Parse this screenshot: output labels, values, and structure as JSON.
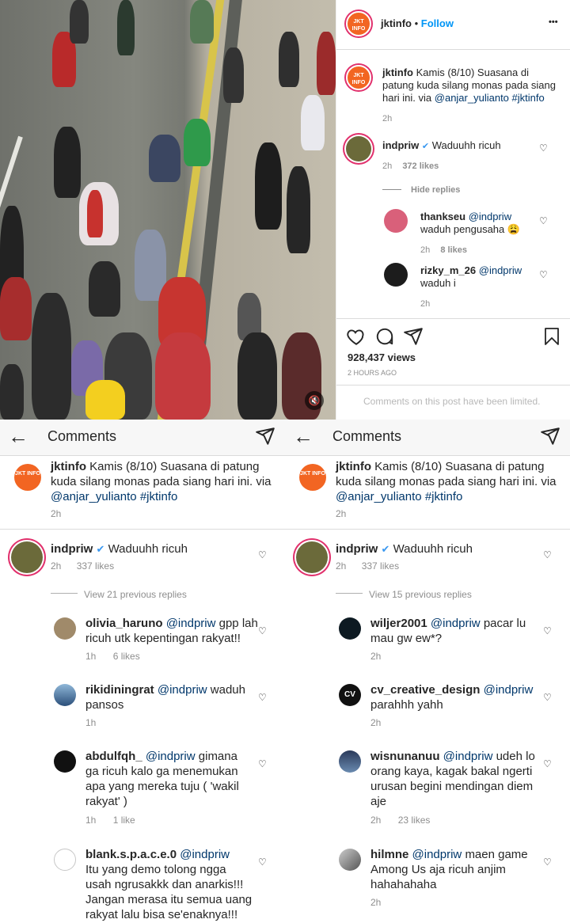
{
  "post": {
    "username": "jktinfo",
    "follow": "Follow",
    "avatar_text": "JKT INFO",
    "more": "•••",
    "caption_user": "jktinfo",
    "caption": "Kamis (8/10) Suasana di patung kuda silang monas pada siang hari ini. via",
    "caption_mention": "@anjar_yulianto",
    "caption_tag": "#jktinfo",
    "caption_time": "2h",
    "views": "928,437 views",
    "time_ago": "2 HOURS AGO",
    "limited": "Comments on this post have been limited.",
    "mute_icon": "mute-icon"
  },
  "panel_comments": {
    "main": {
      "user": "indpriw",
      "verified": "✔",
      "text": "Waduuhh ricuh",
      "time": "2h",
      "likes": "372 likes"
    },
    "hide_replies": "Hide replies",
    "replies": [
      {
        "user": "thankseu",
        "mention": "@indpriw",
        "text": "waduh pengusaha 😩",
        "time": "2h",
        "likes": "8 likes"
      },
      {
        "user": "rizky_m_26",
        "mention": "@indpriw",
        "text": "waduh i",
        "time": "2h",
        "likes": ""
      }
    ]
  },
  "left": {
    "header": "Comments",
    "caption_user": "jktinfo",
    "caption": "Kamis (8/10) Suasana di patung kuda silang monas pada siang hari ini.",
    "caption_via": "via",
    "caption_mention": "@anjar_yulianto",
    "caption_tag": "#jktinfo",
    "caption_time": "2h",
    "main": {
      "user": "indpriw",
      "text": "Waduuhh ricuh",
      "time": "2h",
      "likes": "337 likes"
    },
    "view_replies": "View 21 previous replies",
    "replies": [
      {
        "user": "olivia_haruno",
        "mention": "@indpriw",
        "line1": "gpp lah",
        "line2": "ricuh utk kepentingan rakyat!!",
        "line3": "",
        "line4": "",
        "time": "1h",
        "likes": "6 likes"
      },
      {
        "user": "rikidiningrat",
        "mention": "@indpriw",
        "line1": "waduh",
        "line2": "pansos",
        "line3": "",
        "line4": "",
        "time": "1h",
        "likes": ""
      },
      {
        "user": "abdulfqh_",
        "mention": "@indpriw",
        "line1": "gimana",
        "line2": "ga ricuh kalo ga menemukan",
        "line3": "apa yang mereka tuju ( 'wakil",
        "line4": "rakyat' )",
        "time": "1h",
        "likes": "1 like"
      },
      {
        "user": "blank.s.p.a.c.e.0",
        "mention": "@indpriw",
        "line1": "",
        "line2": "Itu yang demo tolong ngga",
        "line3": "usah ngrusakkk dan anarkis!!!",
        "line4": "Jangan merasa itu semua uang",
        "line5": "rakyat lalu bisa se'enaknya!!!",
        "time": "",
        "likes": ""
      }
    ]
  },
  "right": {
    "header": "Comments",
    "caption_user": "jktinfo",
    "caption": "Kamis (8/10) Suasana di patung kuda silang monas pada siang hari ini.",
    "caption_via": "via",
    "caption_mention": "@anjar_yulianto",
    "caption_tag": "#jktinfo",
    "caption_time": "2h",
    "main": {
      "user": "indpriw",
      "text": "Waduuhh ricuh",
      "time": "2h",
      "likes": "337 likes"
    },
    "view_replies": "View 15 previous replies",
    "replies": [
      {
        "user": "wiljer2001",
        "mention": "@indpriw",
        "line1": "pacar lu",
        "line2": "mau gw ew*?",
        "line3": "",
        "line4": "",
        "time": "2h",
        "likes": ""
      },
      {
        "user": "cv_creative_design",
        "mention": "@indpriw",
        "line1": "",
        "line2": "parahhh yahh",
        "line3": "",
        "line4": "",
        "time": "2h",
        "likes": ""
      },
      {
        "user": "wisnunanuu",
        "mention": "@indpriw",
        "line1": "udeh lo",
        "line2": "orang kaya, kagak bakal ngerti",
        "line3": "urusan begini mendingan diem",
        "line4": "aje",
        "time": "2h",
        "likes": "23 likes"
      },
      {
        "user": "hilmne",
        "mention": "@indpriw",
        "line1": "maen game",
        "line2": "Among Us aja ricuh anjim",
        "line3": "hahahahaha",
        "line4": "",
        "time": "2h",
        "likes": ""
      }
    ]
  },
  "icons": {
    "heart": "♡",
    "back": "←"
  },
  "avatar_cv": "CV"
}
